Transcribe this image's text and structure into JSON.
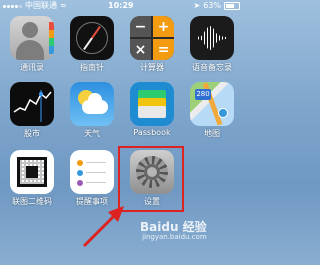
{
  "status_bar": {
    "carrier": "中国联通",
    "time": "10:29",
    "battery": "63%"
  },
  "apps": [
    {
      "label": "通讯录",
      "icon": "contacts-icon"
    },
    {
      "label": "指南针",
      "icon": "compass-icon"
    },
    {
      "label": "计算器",
      "icon": "calculator-icon"
    },
    {
      "label": "语音备忘录",
      "icon": "voice-memos-icon"
    },
    {
      "label": "股市",
      "icon": "stocks-icon"
    },
    {
      "label": "天气",
      "icon": "weather-icon"
    },
    {
      "label": "Passbook",
      "icon": "passbook-icon"
    },
    {
      "label": "地图",
      "icon": "maps-icon",
      "shield_number": "280"
    },
    {
      "label": "联图二维码",
      "icon": "qr-code-icon"
    },
    {
      "label": "提醒事项",
      "icon": "reminders-icon"
    },
    {
      "label": "设置",
      "icon": "settings-icon"
    }
  ],
  "annotation": {
    "color": "#dd2222"
  },
  "watermark": {
    "brand": "Baidu 经验",
    "url": "jingyan.baidu.com"
  },
  "colors": {
    "wallpaper_top": "#9fc0de",
    "wallpaper_bottom": "#6f98c2"
  }
}
